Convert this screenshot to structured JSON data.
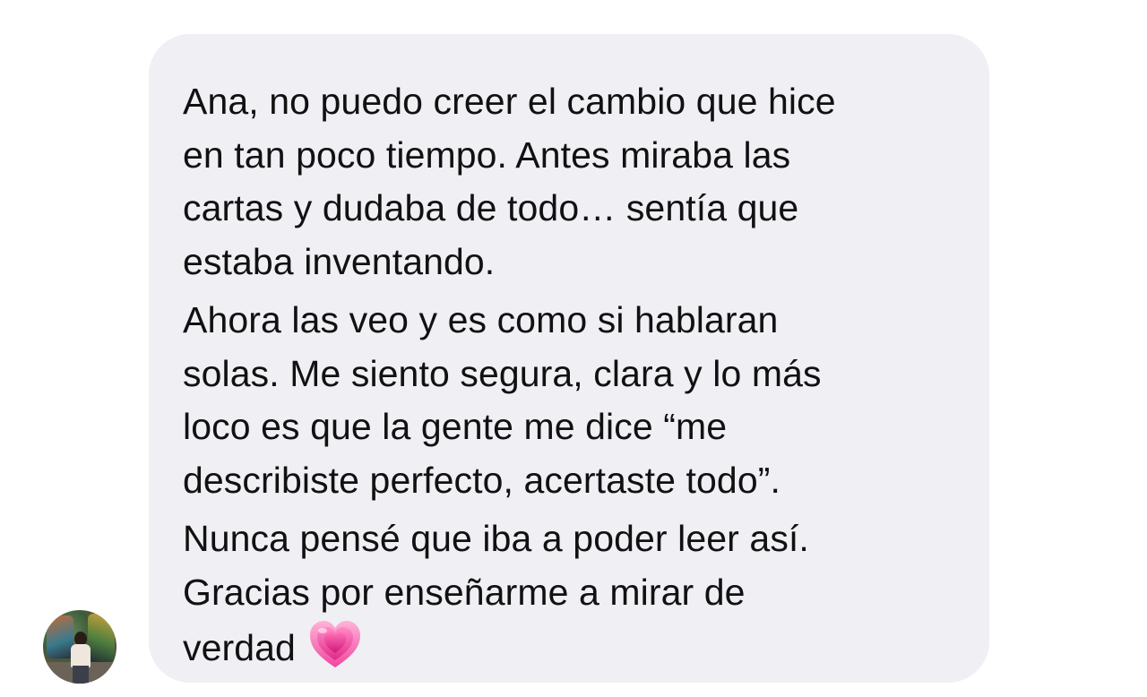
{
  "message": {
    "paragraphs": [
      {
        "lines": [
          "Ana, no puedo creer el cambio que hice",
          "en tan poco tiempo. Antes miraba las",
          "cartas y dudaba de todo… sentía que",
          "estaba inventando."
        ]
      },
      {
        "lines": [
          "Ahora las veo y es como si hablaran",
          "solas. Me siento segura, clara y lo más",
          "loco es que la gente me dice “me",
          "describiste perfecto, acertaste todo”."
        ]
      },
      {
        "lines": [
          "Nunca pensé que iba a poder leer así.",
          "Gracias por enseñarme a mirar de",
          "verdad"
        ]
      }
    ],
    "trailing_emoji": "growing-heart-icon"
  },
  "colors": {
    "bubble_background": "#efeff4",
    "text": "#111111",
    "page_background": "#ffffff",
    "heart": "#f25fa8"
  }
}
